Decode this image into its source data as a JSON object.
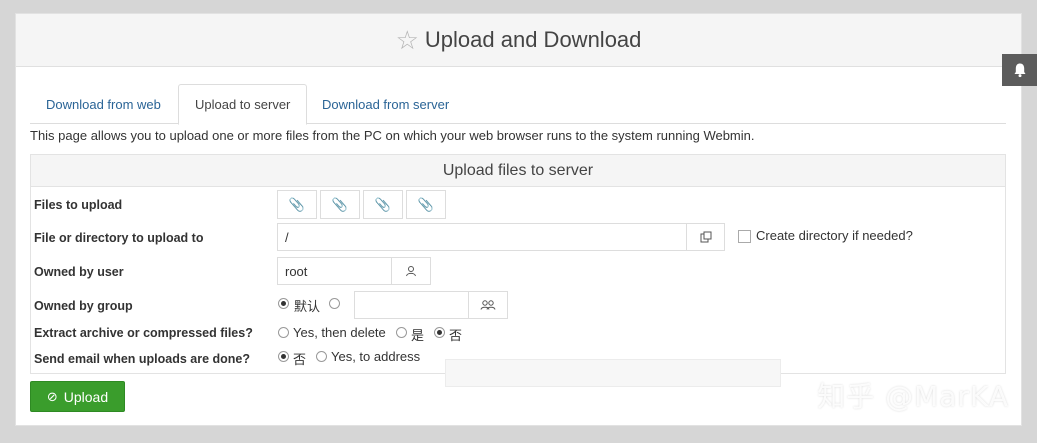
{
  "header": {
    "title": "Upload and Download",
    "icon": "star-outline-icon"
  },
  "tabs": [
    {
      "label": "Download from web",
      "active": false
    },
    {
      "label": "Upload to server",
      "active": true
    },
    {
      "label": "Download from server",
      "active": false
    }
  ],
  "intro": "This page allows you to upload one or more files from the PC on which your web browser runs to the system running Webmin.",
  "form": {
    "title": "Upload files to server",
    "files_label": "Files to upload",
    "file_buttons": [
      "paperclip-icon",
      "paperclip-icon",
      "paperclip-icon",
      "paperclip-icon"
    ],
    "dir_label": "File or directory to upload to",
    "dir_value": "/",
    "mkdir_label": "Create directory if needed?",
    "mkdir_checked": false,
    "user_label": "Owned by user",
    "user_value": "root",
    "group_label": "Owned by group",
    "group_default_label": "默认",
    "group_selected": "default",
    "group_value": "",
    "extract_label": "Extract archive or compressed files?",
    "extract_opt_delete": "Yes, then delete",
    "extract_opt_yes": "是",
    "extract_opt_no": "否",
    "extract_selected": "no",
    "email_label": "Send email when uploads are done?",
    "email_opt_no": "否",
    "email_opt_yes": "Yes, to address",
    "email_selected": "no",
    "email_value": ""
  },
  "upload_button": "Upload",
  "watermark": "知乎 @MarKA",
  "colors": {
    "upload_green": "#3a9d2c",
    "link_blue": "#2a6496"
  }
}
